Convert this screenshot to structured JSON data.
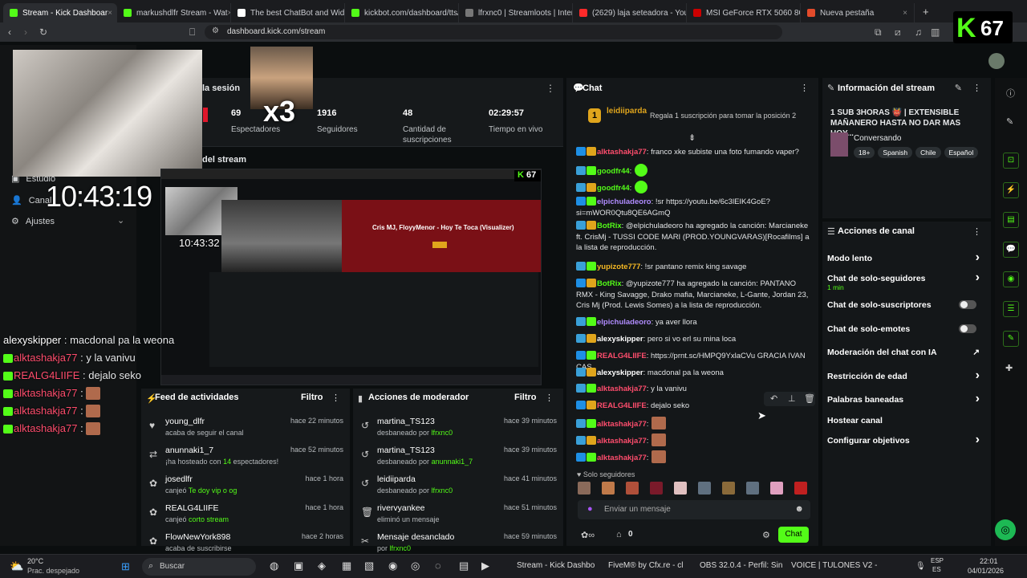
{
  "browser": {
    "tabs": [
      {
        "label": "Stream - Kick Dashboar",
        "color": "#53fc18",
        "active": true
      },
      {
        "label": "markushdlfr Stream - Wat",
        "color": "#53fc18"
      },
      {
        "label": "The best ChatBot and Widget",
        "color": "#ffffff"
      },
      {
        "label": "kickbot.com/dashboard/tts/c",
        "color": "#53fc18"
      },
      {
        "label": "lfrxnc0 | Streamloots | Interac",
        "color": "#777777"
      },
      {
        "label": "(2629) laja seteadora - YouTub",
        "color": "#ff2a2a"
      },
      {
        "label": "MSI GeForce RTX 5060 8G SH",
        "color": "#cc0000"
      },
      {
        "label": "Nueva pestaña",
        "color": "#e34b2b"
      }
    ],
    "url": "dashboard.kick.com/stream"
  },
  "overlay": {
    "viewer_badge": "67",
    "x3": "x3",
    "clock": "10:43:19",
    "clock_small": "10:43:32",
    "preview_song": "Cris MJ, FloyyMenor - Hoy Te Toca (Visualizer)",
    "preview_badge": "67",
    "chat_overlay": [
      {
        "user": "alexyskipper",
        "text": " : macdonal pa la weona",
        "color": "#ffffff"
      },
      {
        "user": "alktashakja77",
        "text": " : y la vanivu",
        "color": "#ff4d6d"
      },
      {
        "user": "REALG4LIIFE",
        "text": " : dejalo seko",
        "color": "#ff4d6d"
      },
      {
        "user": "alktashakja77",
        "text": " : ",
        "color": "#ff4d6d"
      },
      {
        "user": "alktashakja77",
        "text": " : ",
        "color": "#ff4d6d"
      },
      {
        "user": "alktashakja77",
        "text": " : ",
        "color": "#ff4d6d"
      }
    ]
  },
  "left_nav": {
    "items": [
      "Estudio",
      "Canal",
      "Ajustes"
    ],
    "session_title": "la sesión",
    "stream_title": "del stream"
  },
  "stats": [
    {
      "value": "69",
      "label": "Espectadores"
    },
    {
      "value": "1916",
      "label": "Seguidores"
    },
    {
      "value": "48",
      "label": "Cantidad de suscripciones"
    },
    {
      "value": "02:29:57",
      "label": "Tiempo en vivo"
    }
  ],
  "feed": {
    "title": "Feed de actividades",
    "filter": "Filtro",
    "items": [
      {
        "icon": "heart-icon",
        "glyph": "♥",
        "name": "young_dlfr",
        "sub": "acaba de seguir el canal",
        "time": "hace 22 minutos"
      },
      {
        "icon": "host-icon",
        "glyph": "⇄",
        "name": "anunnaki1_7",
        "sub": "¡ha hosteado con 14 espectadores!",
        "time": "hace 52 minutos"
      },
      {
        "icon": "points-icon",
        "glyph": "✿",
        "name": "josedlfr",
        "sub": "canjeó Te doy vip o og",
        "time": "hace 1 hora"
      },
      {
        "icon": "points-icon",
        "glyph": "✿",
        "name": "REALG4LIIFE",
        "sub": "canjeó corto stream",
        "time": "hace 1 hora"
      },
      {
        "icon": "points-icon",
        "glyph": "✿",
        "name": "FlowNewYork898",
        "sub": "acaba de suscribirse",
        "time": "hace 2 horas"
      }
    ]
  },
  "modactions": {
    "title": "Acciones de moderador",
    "filter": "Filtro",
    "items": [
      {
        "icon": "unban-icon",
        "glyph": "↺",
        "name": "martina_TS123",
        "sub": "desbaneado por lfrxnc0",
        "time": "hace 39 minutos"
      },
      {
        "icon": "unban-icon",
        "glyph": "↺",
        "name": "martina_TS123",
        "sub": "desbaneado por anunnaki1_7",
        "time": "hace 39 minutos"
      },
      {
        "icon": "unban-icon",
        "glyph": "↺",
        "name": "leidiiparda",
        "sub": "desbaneado por lfrxnc0",
        "time": "hace 41 minutos"
      },
      {
        "icon": "trash-icon",
        "glyph": "🗑",
        "name": "rivervyankee",
        "sub": "eliminó un mensaje",
        "time": "hace 51 minutos"
      },
      {
        "icon": "pin-icon",
        "glyph": "✂",
        "name": "Mensaje desanclado",
        "sub": "por lfrxnc0",
        "time": "hace 59 minutos"
      }
    ]
  },
  "chat": {
    "title": "Chat",
    "top_user": "leidiiparda",
    "top_rank": "1",
    "gift_prompt": "Regala 1 suscripción para tomar la posición 2",
    "messages": [
      {
        "user": "alktashakja77",
        "color": "#ff4d6d",
        "text": ": franco xke subiste una foto fumando vaper?"
      },
      {
        "user": "goodfr44",
        "color": "#53fc18",
        "text": ":"
      },
      {
        "user": "goodfr44",
        "color": "#53fc18",
        "text": ":"
      },
      {
        "user": "elpichuladeoro",
        "color": "#b08cff",
        "text": ": !sr https://youtu.be/6c3lEIK4GoE?si=mWOR0Qtu8QE6AGmQ"
      },
      {
        "user": "BotRix",
        "color": "#53fc18",
        "text": ": @elpichuladeoro ha agregado la canción: Marcianeke ft. CrisMj - TUSSI CODE MARI (PROD.YOUNGVARAS)[Rocafilms] a la lista de reproducción."
      },
      {
        "user": "yupizote777",
        "color": "#f5b823",
        "text": ": !sr pantano remix king savage"
      },
      {
        "user": "BotRix",
        "color": "#53fc18",
        "text": ": @yupizote777 ha agregado la canción: PANTANO RMX - King Savagge, Drako mafia, Marcianeke, L-Gante, Jordan 23, Cris Mj (Prod. Lewis Somes) a la lista de reproducción."
      },
      {
        "user": "elpichuladeoro",
        "color": "#b08cff",
        "text": ": ya aver llora"
      },
      {
        "user": "alexyskipper",
        "color": "#ffffff",
        "text": ": pero si vo erl su mina loca"
      },
      {
        "user": "REALG4LIIFE",
        "color": "#ff4d6d",
        "text": ": https://prnt.sc/HMPQ9YxlaCVu GRACIA IVAN CAS"
      },
      {
        "user": "alexyskipper",
        "color": "#ffffff",
        "text": ": macdonal pa la weona"
      },
      {
        "user": "alktashakja77",
        "color": "#ff4d6d",
        "text": ": y la vanivu"
      },
      {
        "user": "REALG4LIIFE",
        "color": "#ff4d6d",
        "text": ": dejalo seko"
      },
      {
        "user": "alktashakja77",
        "color": "#ff4d6d",
        "text": ":"
      },
      {
        "user": "alktashakja77",
        "color": "#ff4d6d",
        "text": ":"
      },
      {
        "user": "alktashakja77",
        "color": "#ff4d6d",
        "text": ":"
      }
    ],
    "followers_only": "Solo seguidores",
    "input_placeholder": "Enviar un mensaje",
    "points": "0",
    "send_label": "Chat"
  },
  "info": {
    "title": "Información del stream",
    "stream_title": "1 SUB 3HORAS 👹 | EXTENSIBLE MAÑANERO HASTA NO DAR MAS HOY...",
    "category": "Conversando",
    "tags": [
      "18+",
      "Spanish",
      "Chile",
      "Español"
    ]
  },
  "channel_actions": {
    "title": "Acciones de canal",
    "items": [
      {
        "label": "Modo lento",
        "control": "chevron"
      },
      {
        "label": "Chat de solo-seguidores",
        "sub": "1 min",
        "control": "chevron"
      },
      {
        "label": "Chat de solo-suscriptores",
        "control": "toggle"
      },
      {
        "label": "Chat de solo-emotes",
        "control": "toggle"
      },
      {
        "label": "Moderación del chat con IA",
        "control": "external"
      },
      {
        "label": "Restricción de edad",
        "control": "chevron"
      },
      {
        "label": "Palabras baneadas",
        "control": "chevron"
      },
      {
        "label": "Hostear canal",
        "control": "none"
      },
      {
        "label": "Configurar objetivos",
        "control": "chevron"
      }
    ]
  },
  "taskbar": {
    "weather_temp": "20°C",
    "weather_desc": "Prac. despejado",
    "search": "Buscar",
    "apps": [
      "Stream - Kick Dashbo",
      "FiveM® by Cfx.re - cl",
      "OBS 32.0.4 - Perfil: Sin",
      "VOICE | TULONES V2 -"
    ],
    "lang": "ESP",
    "lang2": "ES",
    "time": "22:01",
    "date": "04/01/2026"
  },
  "colors": {
    "kick_green": "#53fc18",
    "panel": "#16191b",
    "background": "#0b0e0f"
  }
}
